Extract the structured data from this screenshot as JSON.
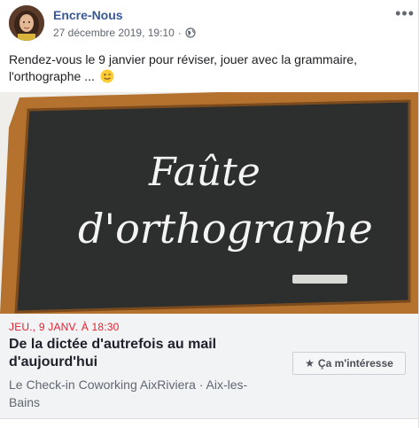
{
  "post": {
    "page_name": "Encre-Nous",
    "timestamp": "27 décembre 2019, 19:10",
    "separator": "·",
    "privacy_icon": "globe-icon",
    "more_icon": "more-horizontal-icon",
    "text_line1": "Rendez-vous le 9 janvier pour réviser, jouer avec la grammaire,",
    "text_line2": "l'orthographe ...",
    "emoji": "winking-face-emoji"
  },
  "image": {
    "line1": "Faûte",
    "line2": "d'orthographe",
    "frame_color": "#b5722f",
    "board_color": "#2d2f2e"
  },
  "event": {
    "date": "JEU., 9 JANV. À 18:30",
    "title": "De la dictée d'autrefois au mail d'aujourd'hui",
    "location": "Le Check-in Coworking AixRiviera · Aix-les-Bains",
    "interest_label": "Ça m'intéresse",
    "interest_icon": "star-icon"
  },
  "colors": {
    "link": "#385898",
    "date_red": "#e4202f",
    "muted": "#606770"
  }
}
